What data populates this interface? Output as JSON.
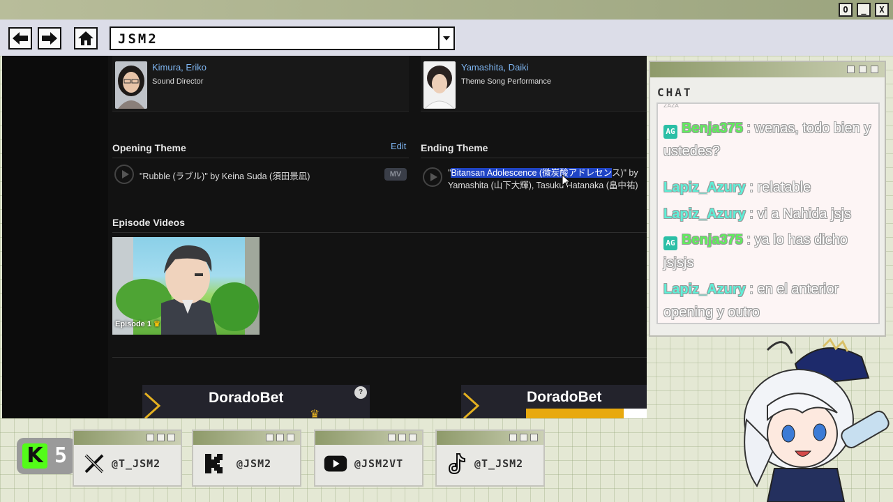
{
  "window": {
    "controls": [
      "O",
      "_",
      "X"
    ]
  },
  "navbar": {
    "address": "JSM2",
    "dropdown_icon": "chevron-down-icon"
  },
  "browser": {
    "staff": [
      {
        "name": "Kimura, Eriko",
        "role": "Sound Director"
      },
      {
        "name": "Yamashita, Daiki",
        "role": "Theme Song Performance"
      }
    ],
    "opening": {
      "title": "Opening Theme",
      "edit_label": "Edit",
      "song": "\"Rubble (ラブル)\" by Keina Suda (須田景凪)",
      "mv_label": "MV"
    },
    "ending": {
      "title": "Ending Theme",
      "quote_open": "\"",
      "song_highlighted": "Bitansan Adolescence (微炭酸アドレセン",
      "song_rest": "ス)\" by",
      "line2": "Yamashita (山下大輝), Tasuku Hatanaka (畠中祐)"
    },
    "episode_videos": {
      "title": "Episode Videos",
      "episode_label": "Episode 1"
    },
    "ads": [
      {
        "brand": "DoradoBet"
      },
      {
        "brand": "DoradoBet"
      }
    ]
  },
  "chat": {
    "title": "CHAT",
    "top_fragment": "ZAZA",
    "messages": [
      {
        "badge": true,
        "user": "Benja375",
        "color": "#5ef05a",
        "text": " : wenas, todo bien y ustedes?"
      },
      {
        "badge": false,
        "user": "Lapiz_Azury",
        "color": "#5ef0d8",
        "text": " : relatable"
      },
      {
        "badge": false,
        "user": "Lapiz_Azury",
        "color": "#5ef0d8",
        "text": " : vi a Nahida jsjs"
      },
      {
        "badge": true,
        "user": "Benja375",
        "color": "#5ef05a",
        "text": " : ya lo has dicho jsjsjs"
      },
      {
        "badge": false,
        "user": "Lapiz_Azury",
        "color": "#5ef0d8",
        "text": " : en el anterior opening y outro"
      }
    ]
  },
  "kick": {
    "logo_letter": "K",
    "viewer_count": "5"
  },
  "socials": [
    {
      "icon": "x-twitter-icon",
      "handle": "@T_JSM2"
    },
    {
      "icon": "kick-icon",
      "handle": "@JSM2"
    },
    {
      "icon": "youtube-icon",
      "handle": "@JSM2VT"
    },
    {
      "icon": "tiktok-icon",
      "handle": "@T_JSM2"
    }
  ],
  "colors": {
    "accent_link": "#7fb6f2",
    "highlight": "#1f44c4",
    "kick_green": "#53fc18",
    "frame_green": "#8e9a6a"
  }
}
